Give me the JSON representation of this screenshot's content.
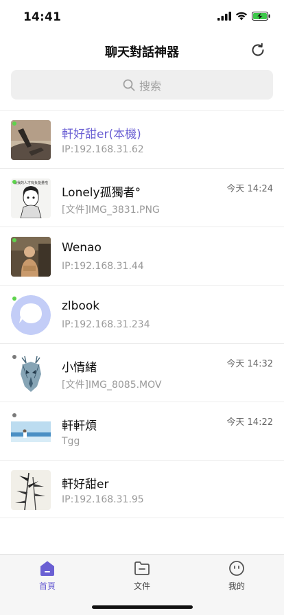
{
  "status_bar": {
    "time": "14:41"
  },
  "nav": {
    "title": "聊天對話神器"
  },
  "search": {
    "placeholder": "搜索"
  },
  "conversations": [
    {
      "name": "軒好甜er(本機)",
      "subtitle": "IP:192.168.31.62",
      "time": "",
      "status": "online",
      "is_self": true
    },
    {
      "name": "Lonely孤獨者°",
      "subtitle": "[文件]IMG_3831.PNG",
      "time": "今天 14:24",
      "status": "online",
      "is_self": false,
      "avatar_caption": "嫌我的人才有负能量啦"
    },
    {
      "name": "Wenao",
      "subtitle": "IP:192.168.31.44",
      "time": "",
      "status": "online",
      "is_self": false
    },
    {
      "name": "zlbook",
      "subtitle": "IP:192.168.31.234",
      "time": "",
      "status": "online",
      "is_self": false
    },
    {
      "name": "小情緒",
      "subtitle": "[文件]IMG_8085.MOV",
      "time": "今天 14:32",
      "status": "offline",
      "is_self": false
    },
    {
      "name": "軒軒煩",
      "subtitle": "Tgg",
      "time": "今天 14:22",
      "status": "offline",
      "is_self": false
    },
    {
      "name": "軒好甜er",
      "subtitle": "IP:192.168.31.95",
      "time": "",
      "status": "none",
      "is_self": false
    }
  ],
  "tabbar": {
    "tabs": [
      {
        "label": "首頁",
        "icon": "home-icon",
        "active": true
      },
      {
        "label": "文件",
        "icon": "folder-icon",
        "active": false
      },
      {
        "label": "我的",
        "icon": "smiley-icon",
        "active": false
      }
    ]
  },
  "colors": {
    "accent": "#6a5fd3",
    "online": "#5ed34c",
    "offline": "#7a7a7a"
  }
}
